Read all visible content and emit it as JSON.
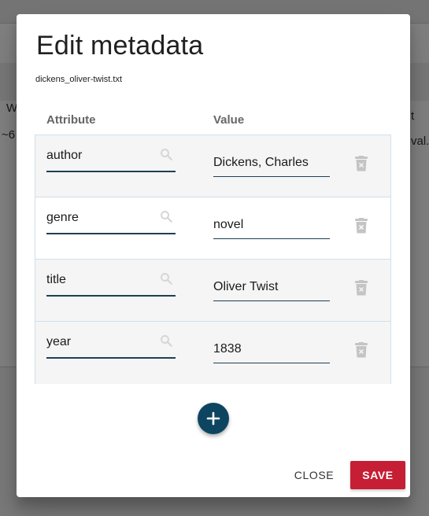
{
  "background": {
    "left_fragments": [
      "W",
      "~6"
    ],
    "right_fragments": [
      "t",
      "val.:"
    ]
  },
  "dialog": {
    "title": "Edit metadata",
    "filename": "dickens_oliver-twist.txt",
    "columns": {
      "attribute": "Attribute",
      "value": "Value"
    },
    "rows": [
      {
        "attribute": "author",
        "value": "Dickens, Charles"
      },
      {
        "attribute": "genre",
        "value": "novel"
      },
      {
        "attribute": "title",
        "value": "Oliver Twist"
      },
      {
        "attribute": "year",
        "value": "1838"
      }
    ],
    "add_icon": "plus-icon",
    "row_icons": {
      "lookup": "search-icon",
      "remove": "trash-icon"
    },
    "buttons": {
      "close": "CLOSE",
      "save": "SAVE"
    }
  },
  "colors": {
    "primary": "#0d4561",
    "danger": "#c61e35",
    "row_stripe": "#f5f5f5",
    "row_border": "#cfe0ec"
  }
}
